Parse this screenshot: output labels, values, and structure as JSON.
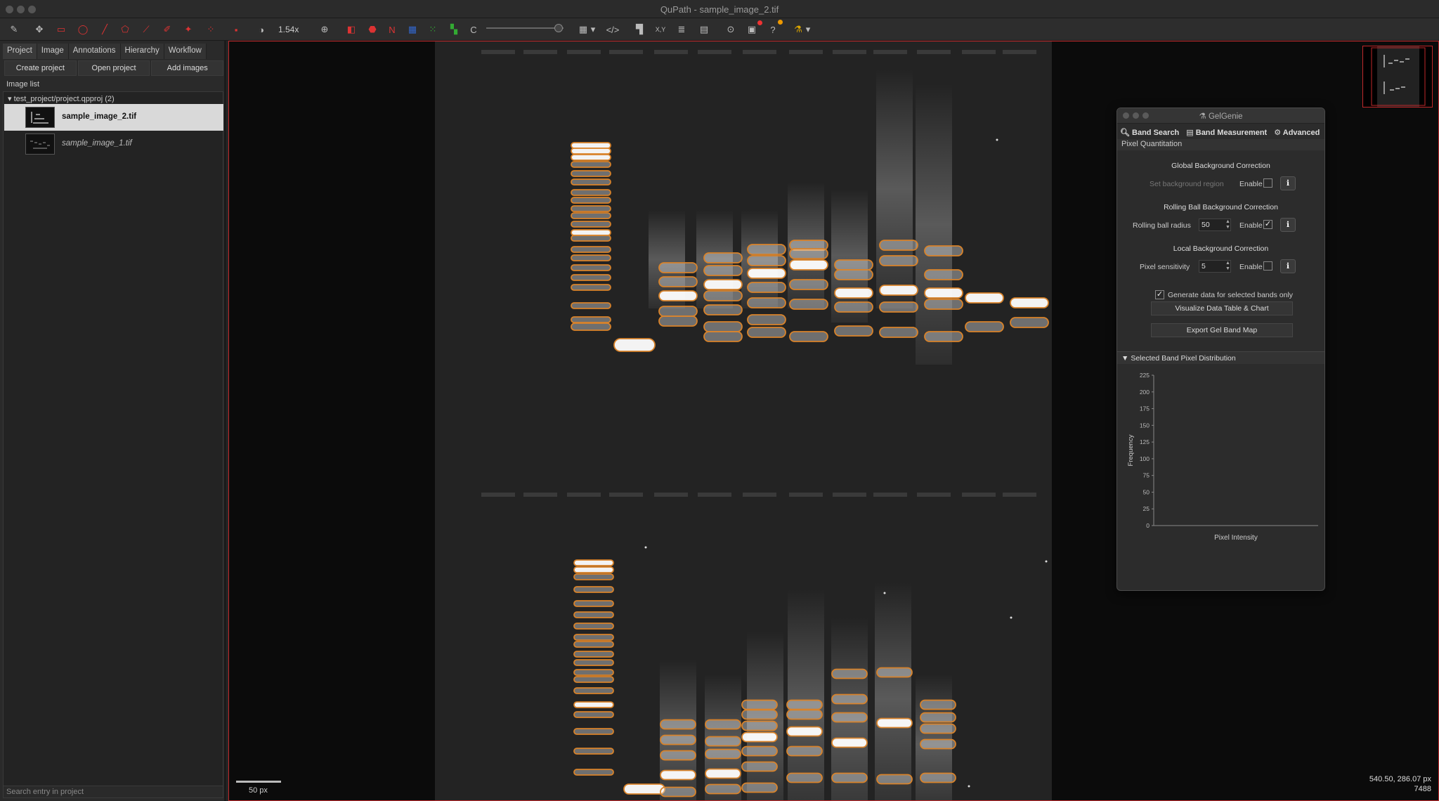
{
  "window": {
    "title": "QuPath - sample_image_2.tif"
  },
  "toolbar": {
    "zoom": "1.54x",
    "c_label": "C",
    "xy_label": "X,Y"
  },
  "left_panel": {
    "tabs": [
      "Project",
      "Image",
      "Annotations",
      "Hierarchy",
      "Workflow"
    ],
    "buttons": {
      "create": "Create project",
      "open": "Open project",
      "add": "Add images"
    },
    "image_list_label": "Image list",
    "project_node": "test_project/project.qpproj (2)",
    "images": [
      "sample_image_2.tif",
      "sample_image_1.tif"
    ],
    "search_placeholder": "Search entry in project"
  },
  "viewer": {
    "scale_label": "50 px",
    "coords": "540.50, 286.07 px",
    "value": "7488"
  },
  "plugin": {
    "title": "GelGenie",
    "tabs": [
      "Band Search",
      "Band Measurement",
      "Advanced"
    ],
    "subheader": "Pixel Quantitation",
    "global": {
      "title": "Global Background Correction",
      "set_region": "Set background region",
      "enable": "Enable",
      "enabled": false
    },
    "rolling": {
      "title": "Rolling Ball Background Correction",
      "label": "Rolling ball radius",
      "value": "50",
      "enable": "Enable",
      "enabled": true
    },
    "local": {
      "title": "Local Background Correction",
      "label": "Pixel sensitivity",
      "value": "5",
      "enable": "Enable",
      "enabled": false
    },
    "selected_only": {
      "label": "Generate data for selected bands only",
      "checked": true
    },
    "visualize_btn": "Visualize Data Table & Chart",
    "export_btn": "Export Gel Band Map",
    "distribution": {
      "header": "Selected Band Pixel Distribution",
      "ylabel": "Frequency",
      "xlabel": "Pixel Intensity",
      "yticks": [
        "225",
        "200",
        "175",
        "150",
        "125",
        "100",
        "75",
        "50",
        "25",
        "0"
      ]
    }
  },
  "chart_data": {
    "type": "bar",
    "xlabel": "Pixel Intensity",
    "ylabel": "Frequency",
    "ylim": [
      0,
      225
    ],
    "series": []
  },
  "colors": {
    "accent_red": "#c0282a",
    "band_outline": "#d9832a"
  }
}
